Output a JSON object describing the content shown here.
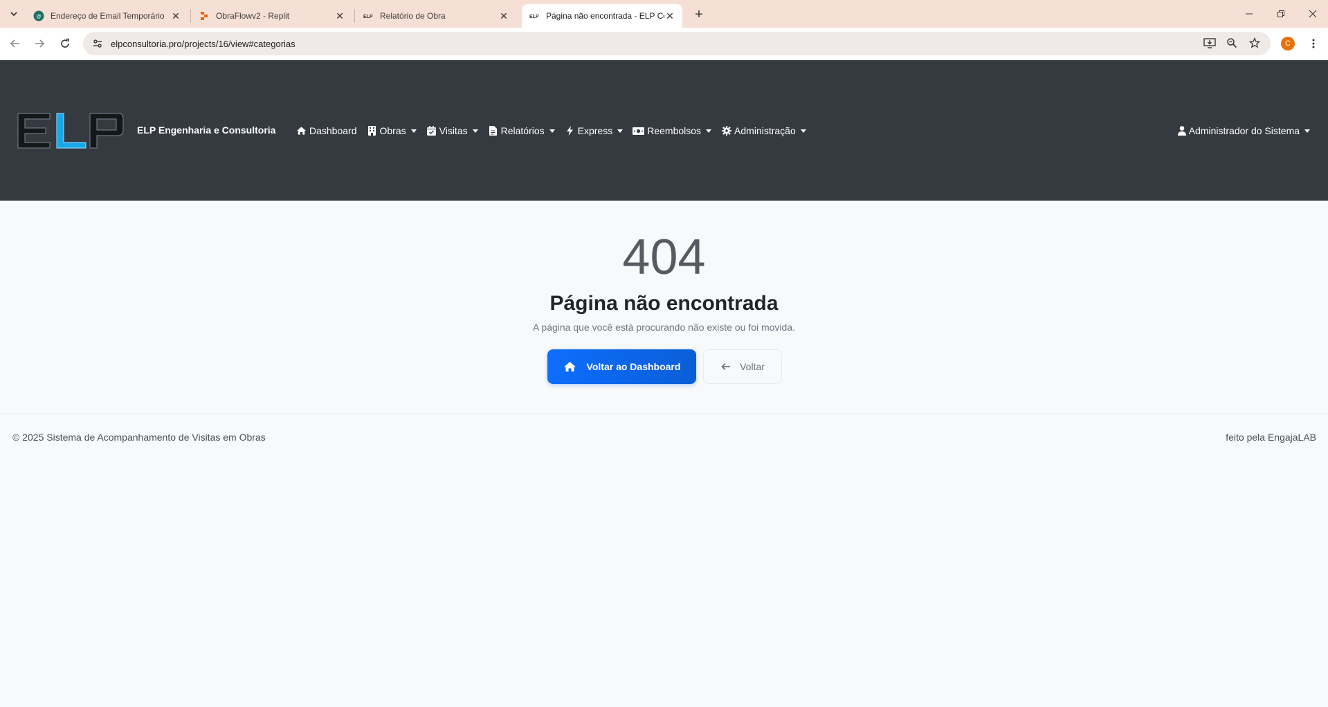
{
  "browser": {
    "tabs": [
      {
        "title": "Endereço de Email Temporário",
        "icon": "temp-mail-favicon",
        "active": false
      },
      {
        "title": "ObraFlowv2 - Replit",
        "icon": "replit-favicon",
        "active": false
      },
      {
        "title": "Relatório de Obra",
        "icon": "elp-favicon",
        "active": false
      },
      {
        "title": "Página não encontrada - ELP Co",
        "icon": "elp-favicon",
        "active": true
      }
    ],
    "url": "elpconsultoria.pro/projects/16/view#categorias",
    "profile_initial": "C",
    "accent": "#f6dfd4"
  },
  "navbar": {
    "brand": "ELP Engenharia e Consultoria",
    "logo_text": "ELP",
    "items": [
      {
        "label": "Dashboard",
        "icon": "home-icon",
        "dropdown": false
      },
      {
        "label": "Obras",
        "icon": "building-icon",
        "dropdown": true
      },
      {
        "label": "Visitas",
        "icon": "calendar-check-icon",
        "dropdown": true
      },
      {
        "label": "Relatórios",
        "icon": "file-icon",
        "dropdown": true
      },
      {
        "label": "Express",
        "icon": "bolt-icon",
        "dropdown": true
      },
      {
        "label": "Reembolsos",
        "icon": "money-bill-icon",
        "dropdown": true
      },
      {
        "label": "Administração",
        "icon": "cog-icon",
        "dropdown": true
      }
    ],
    "user": "Administrador do Sistema",
    "background": "#343a40"
  },
  "error": {
    "code": "404",
    "title": "Página não encontrada",
    "message": "A página que você está procurando não existe ou foi movida.",
    "primary_button": "Voltar ao Dashboard",
    "secondary_button": "Voltar",
    "primary_color": "#0d6efd"
  },
  "footer": {
    "left": "© 2025 Sistema de Acompanhamento de Visitas em Obras",
    "right": "feito pela EngajaLAB"
  }
}
